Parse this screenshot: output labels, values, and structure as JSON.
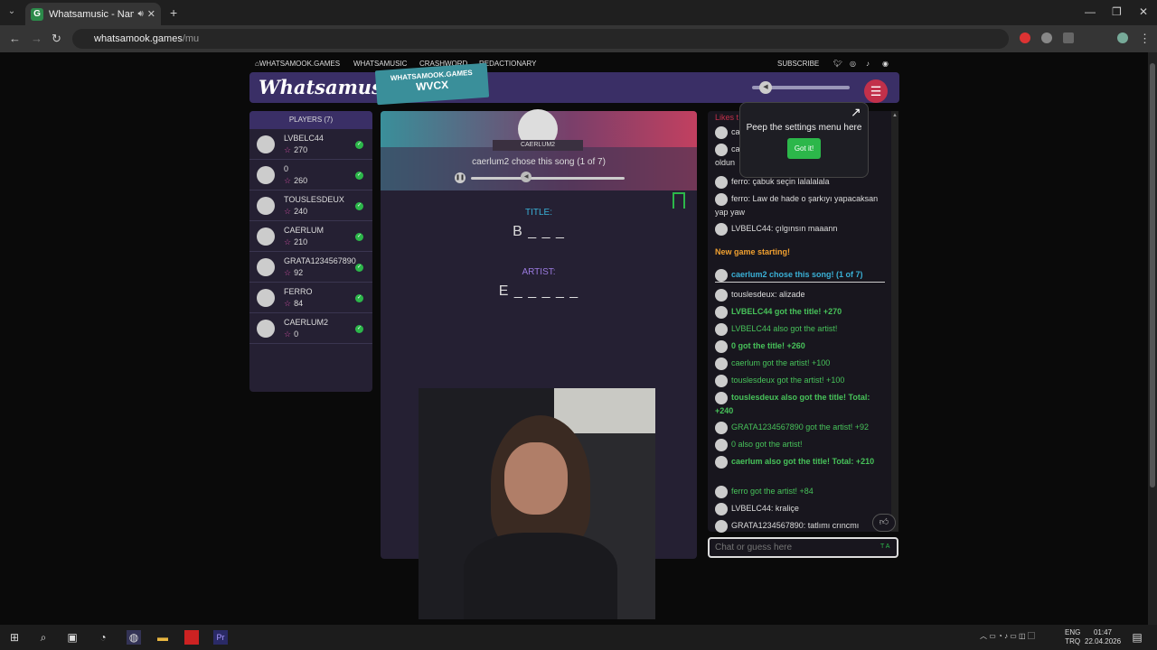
{
  "browser": {
    "tab_title": "Whatsamusic - Name That",
    "tab_favicon": "G",
    "url_host": "whatsamook.games",
    "url_path": "/mu"
  },
  "topnav": {
    "home": "WHATSAMOOK.GAMES",
    "items": [
      "WHATSAMUSIC",
      "CRASHWORD",
      "REDACTIONARY"
    ],
    "subscribe": "SUBSCRIBE"
  },
  "header": {
    "logo": "Whatsamusic",
    "badge_top": "WHATSAMOOK.GAMES",
    "badge_code": "WVCX"
  },
  "players": {
    "heading": "PLAYERS (7)",
    "list": [
      {
        "name": "LVBELC44",
        "score": "270"
      },
      {
        "name": "0",
        "score": "260"
      },
      {
        "name": "TOUSLESDEUX",
        "score": "240"
      },
      {
        "name": "CAERLUM",
        "score": "210"
      },
      {
        "name": "GRATA1234567890",
        "score": "92"
      },
      {
        "name": "FERRO",
        "score": "84"
      },
      {
        "name": "CAERLUM2",
        "score": "0"
      }
    ]
  },
  "game": {
    "chooser": "CAERLUM2",
    "chose_text": "caerlum2 chose this song (1 of 7)",
    "title_label": "TITLE:",
    "title_hint": "B _ _ _",
    "artist_label": "ARTIST:",
    "artist_hint": "E _ _ _ _ _",
    "progress": 0.36
  },
  "tooltip": {
    "text": "Peep the settings menu here",
    "button": "Got it!"
  },
  "chat": {
    "partial_top": "Likes t",
    "partial_lines": [
      "ca",
      "ca",
      "oldun"
    ],
    "messages": [
      {
        "text": "ferro: çabuk seçin lalalalala",
        "style": "normal",
        "avatar": true
      },
      {
        "text": "ferro: Law de hade o şarkıyı yapacaksan yap yaw",
        "style": "normal",
        "avatar": true
      },
      {
        "text": "LVBELC44: çılgınsın maaann",
        "style": "normal",
        "avatar": true
      },
      {
        "text": "New game starting!",
        "style": "orange",
        "avatar": false
      },
      {
        "text": "caerlum2 chose this song! (1 of 7)",
        "style": "teal",
        "avatar": true
      },
      {
        "text": "touslesdeux: alizade",
        "style": "normal",
        "avatar": true
      },
      {
        "text": "LVBELC44 got the title! +270",
        "style": "green",
        "avatar": true
      },
      {
        "text": "LVBELC44 also got the artist!",
        "style": "green2",
        "avatar": true
      },
      {
        "text": "0 got the title! +260",
        "style": "green",
        "avatar": true
      },
      {
        "text": "caerlum got the artist! +100",
        "style": "green2",
        "avatar": true
      },
      {
        "text": "touslesdeux got the artist! +100",
        "style": "green2",
        "avatar": true
      },
      {
        "text": "touslesdeux also got the title! Total: +240",
        "style": "green",
        "avatar": true
      },
      {
        "text": "GRATA1234567890 got the artist! +92",
        "style": "green2",
        "avatar": true
      },
      {
        "text": "0 also got the artist!",
        "style": "green2",
        "avatar": true
      },
      {
        "text": "caerlum also got the title! Total: +210",
        "style": "green",
        "avatar": true
      },
      {
        "text": "ferro got the artist! +84",
        "style": "green2",
        "avatar": true
      },
      {
        "text": "LVBELC44: kraliçe",
        "style": "normal",
        "avatar": true
      },
      {
        "text": "GRATA1234567890: tatlımı crıncmı",
        "style": "normal",
        "avatar": true
      }
    ],
    "input_placeholder": "Chat or guess here"
  },
  "taskbar": {
    "lang": "ENG",
    "lang2": "TRQ",
    "time": "01:47",
    "date": "22.04.2026"
  }
}
